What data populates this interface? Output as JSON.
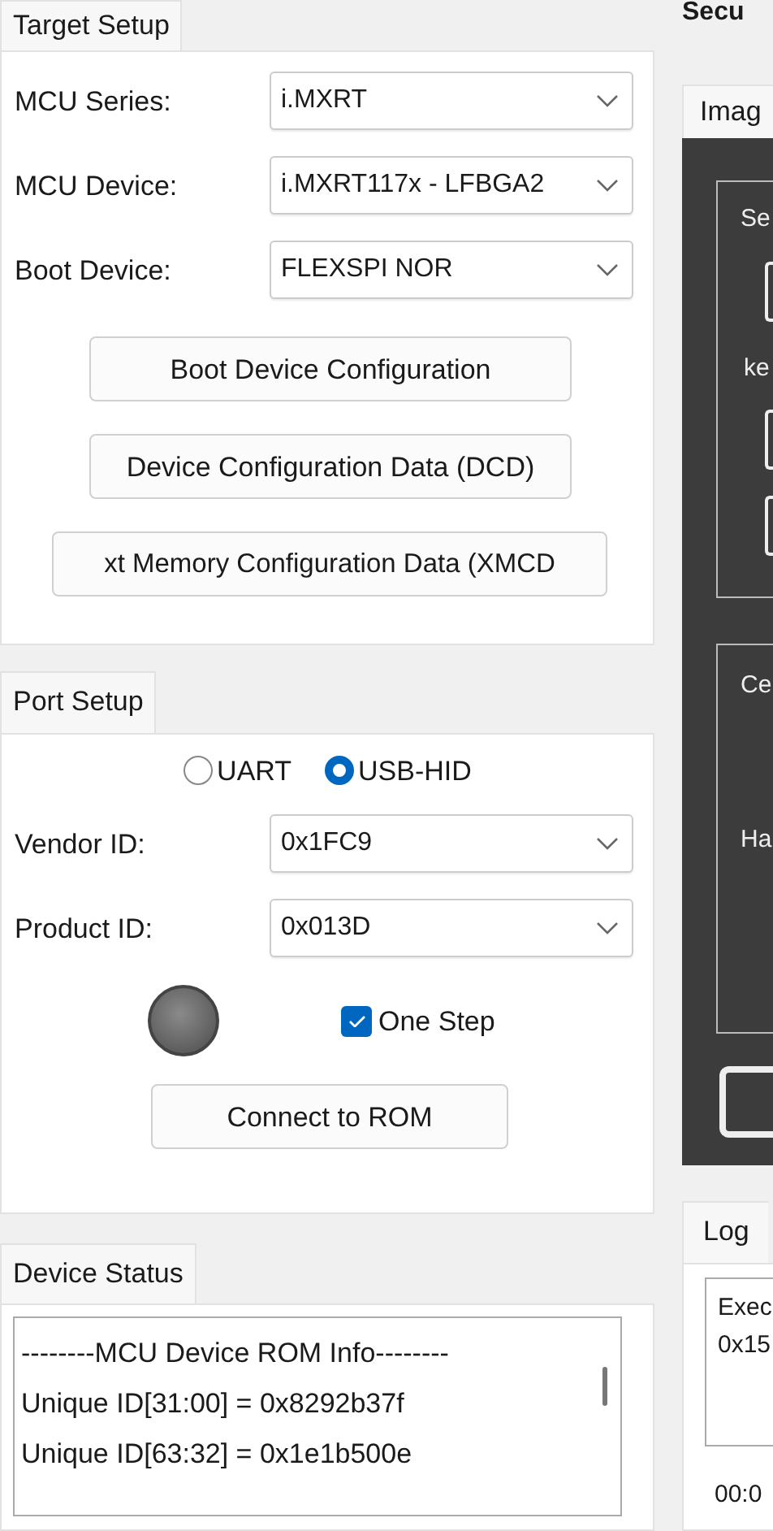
{
  "target_setup": {
    "tab": "Target Setup",
    "fields": [
      {
        "label": "MCU Series:",
        "value": "i.MXRT"
      },
      {
        "label": "MCU Device:",
        "value": "i.MXRT117x - LFBGA2"
      },
      {
        "label": "Boot Device:",
        "value": "FLEXSPI NOR"
      }
    ],
    "buttons": [
      "Boot Device Configuration",
      "Device Configuration Data (DCD)",
      "xt Memory Configuration Data (XMCD"
    ]
  },
  "port_setup": {
    "tab": "Port Setup",
    "radios": [
      {
        "label": "UART",
        "selected": false
      },
      {
        "label": "USB-HID",
        "selected": true
      }
    ],
    "fields": [
      {
        "label": "Vendor ID:",
        "value": "0x1FC9"
      },
      {
        "label": "Product ID:",
        "value": "0x013D"
      }
    ],
    "one_step": {
      "label": "One Step",
      "checked": true
    },
    "connect_button": "Connect to ROM"
  },
  "device_status": {
    "tab": "Device Status",
    "lines": [
      "--------MCU Device ROM Info--------",
      "Unique ID[31:00] = 0x8292b37f",
      "Unique ID[63:32] = 0x1e1b500e"
    ]
  },
  "security": {
    "heading": "Secu",
    "image_tab": "Imag",
    "box_1_labels": [
      "Se",
      "ke"
    ],
    "box_2_labels": [
      "Ce",
      "Ha"
    ]
  },
  "log": {
    "tab": "Log",
    "lines": [
      "Exec",
      "0x15"
    ],
    "time": "00:0"
  }
}
